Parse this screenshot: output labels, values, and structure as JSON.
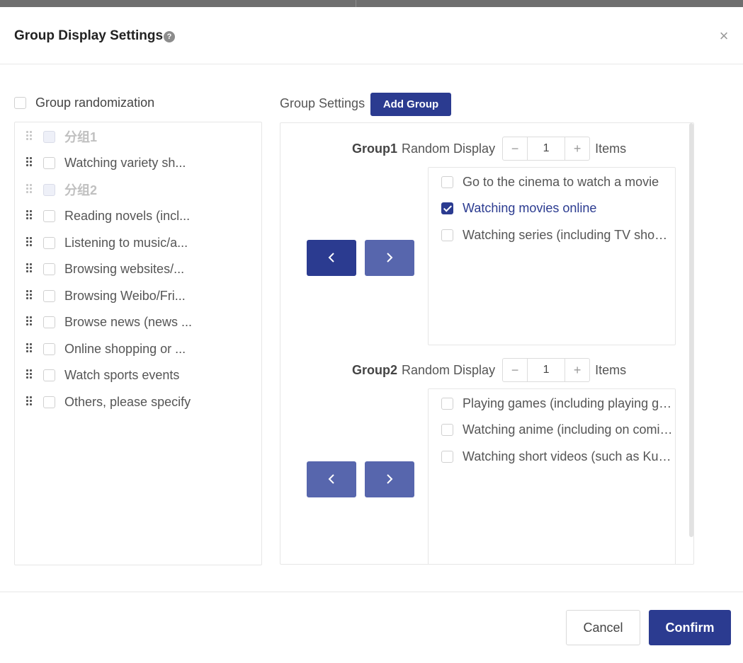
{
  "dialog": {
    "title": "Group Display Settings",
    "help_icon": "?",
    "close_icon": "×"
  },
  "randomization": {
    "label": "Group randomization",
    "checked": false
  },
  "left_list": [
    {
      "label": "分组1",
      "type": "group"
    },
    {
      "label": "Watching variety sh...",
      "type": "item"
    },
    {
      "label": "分组2",
      "type": "group"
    },
    {
      "label": "Reading novels (incl...",
      "type": "item"
    },
    {
      "label": "Listening to music/a...",
      "type": "item"
    },
    {
      "label": "Browsing websites/...",
      "type": "item"
    },
    {
      "label": "Browsing Weibo/Fri...",
      "type": "item"
    },
    {
      "label": "Browse news (news ...",
      "type": "item"
    },
    {
      "label": "Online shopping or ...",
      "type": "item"
    },
    {
      "label": "Watch sports events",
      "type": "item"
    },
    {
      "label": "Others, please specify",
      "type": "item"
    }
  ],
  "group_settings": {
    "label": "Group Settings",
    "add_group_label": "Add Group"
  },
  "groups": [
    {
      "name": "Group1",
      "random_label": "Random Display",
      "minus": "−",
      "value": "1",
      "plus": "+",
      "items_label": "Items",
      "prev": "‹",
      "next": "›",
      "items": [
        {
          "label": "Go to the cinema to watch a movie",
          "checked": false
        },
        {
          "label": "Watching movies online",
          "checked": true
        },
        {
          "label": "Watching series (including TV shows, etc.)",
          "checked": false
        }
      ]
    },
    {
      "name": "Group2",
      "random_label": "Random Display",
      "minus": "−",
      "value": "1",
      "plus": "+",
      "items_label": "Items",
      "prev": "‹",
      "next": "›",
      "items": [
        {
          "label": "Playing games (including playing games on phone, etc.)",
          "checked": false
        },
        {
          "label": "Watching anime (including on comics apps, etc.)",
          "checked": false
        },
        {
          "label": "Watching short videos (such as Kuaishou, etc.)",
          "checked": false
        }
      ]
    }
  ],
  "footer": {
    "cancel_label": "Cancel",
    "confirm_label": "Confirm"
  },
  "colors": {
    "primary": "#2b3b90",
    "primary_light": "#5766ad",
    "border": "#e6e6e6"
  }
}
